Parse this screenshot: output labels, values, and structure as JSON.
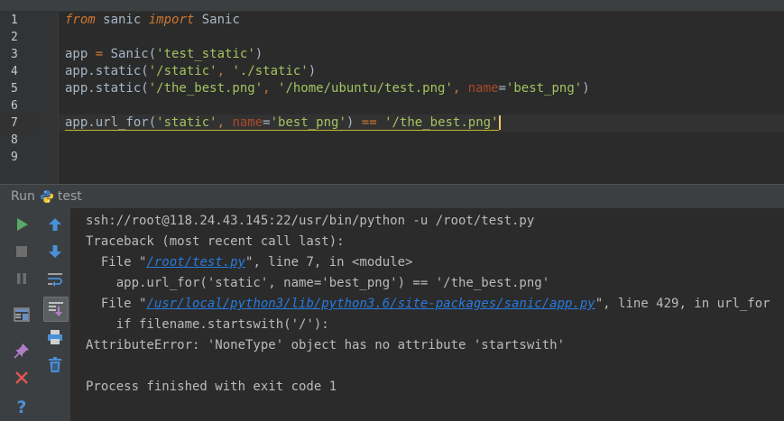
{
  "editor": {
    "line_numbers": [
      "1",
      "2",
      "3",
      "4",
      "5",
      "6",
      "7",
      "8",
      "9"
    ],
    "current_line": 7,
    "lines": [
      [
        {
          "t": "from",
          "c": "kw"
        },
        {
          "t": " sanic ",
          "c": "plain"
        },
        {
          "t": "import",
          "c": "kw"
        },
        {
          "t": " Sanic",
          "c": "plain"
        }
      ],
      [],
      [
        {
          "t": "app ",
          "c": "plain"
        },
        {
          "t": "=",
          "c": "kw2"
        },
        {
          "t": " Sanic(",
          "c": "plain"
        },
        {
          "t": "'test_static'",
          "c": "str2"
        },
        {
          "t": ")",
          "c": "plain"
        }
      ],
      [
        {
          "t": "app.static(",
          "c": "plain"
        },
        {
          "t": "'/static'",
          "c": "str2"
        },
        {
          "t": ", ",
          "c": "kw2"
        },
        {
          "t": "'./static'",
          "c": "str2"
        },
        {
          "t": ")",
          "c": "plain"
        }
      ],
      [
        {
          "t": "app.static(",
          "c": "plain"
        },
        {
          "t": "'/the_best.png'",
          "c": "str2"
        },
        {
          "t": ", ",
          "c": "kw2"
        },
        {
          "t": "'/home/ubuntu/test.png'",
          "c": "str2"
        },
        {
          "t": ", ",
          "c": "kw2"
        },
        {
          "t": "name",
          "c": "param"
        },
        {
          "t": "=",
          "c": "plain"
        },
        {
          "t": "'best_png'",
          "c": "str2"
        },
        {
          "t": ")",
          "c": "plain"
        }
      ],
      [],
      [
        {
          "t": "app.url_for(",
          "c": "plain"
        },
        {
          "t": "'static'",
          "c": "str2"
        },
        {
          "t": ", ",
          "c": "kw2"
        },
        {
          "t": "name",
          "c": "param"
        },
        {
          "t": "=",
          "c": "plain"
        },
        {
          "t": "'best_png'",
          "c": "str2"
        },
        {
          "t": ") ",
          "c": "plain"
        },
        {
          "t": "==",
          "c": "kw2"
        },
        {
          "t": " ",
          "c": "plain"
        },
        {
          "t": "'/the_best.png'",
          "c": "str2"
        }
      ],
      [],
      []
    ]
  },
  "run_panel": {
    "label": "Run",
    "config_name": "test",
    "toolbar_left": [
      "run-icon",
      "stop-icon",
      "pause-icon",
      "layout-icon",
      "pin-icon",
      "close-icon",
      "help-icon"
    ],
    "toolbar_right": [
      "up-arrow-icon",
      "down-arrow-icon",
      "soft-wrap-icon",
      "scroll-to-end-icon",
      "print-icon",
      "trash-icon"
    ]
  },
  "console": {
    "lines": [
      [
        {
          "t": "ssh://root@118.24.43.145:22/usr/bin/python -u /root/test.py"
        }
      ],
      [
        {
          "t": "Traceback (most recent call last):"
        }
      ],
      [
        {
          "t": "  File \""
        },
        {
          "t": "/root/test.py",
          "link": true
        },
        {
          "t": "\", line 7, in <module>"
        }
      ],
      [
        {
          "t": "    app.url_for('static', name='best_png') == '/the_best.png'"
        }
      ],
      [
        {
          "t": "  File \""
        },
        {
          "t": "/usr/local/python3/lib/python3.6/site-packages/sanic/app.py",
          "link": true
        },
        {
          "t": "\", line 429, in url_for"
        }
      ],
      [
        {
          "t": "    if filename.startswith('/'):"
        }
      ],
      [
        {
          "t": "AttributeError: 'NoneType' object has no attribute 'startswith'"
        }
      ],
      [
        {
          "t": ""
        }
      ],
      [
        {
          "t": "Process finished with exit code 1"
        }
      ]
    ]
  },
  "colors": {
    "background": "#2b2b2b",
    "gutter": "#313335",
    "toolbar": "#3c3f41",
    "keyword": "#cc7832",
    "string": "#a5c261",
    "param": "#aa4926",
    "link": "#287bde",
    "run_green": "#59a869",
    "stop_red": "#e05555"
  }
}
